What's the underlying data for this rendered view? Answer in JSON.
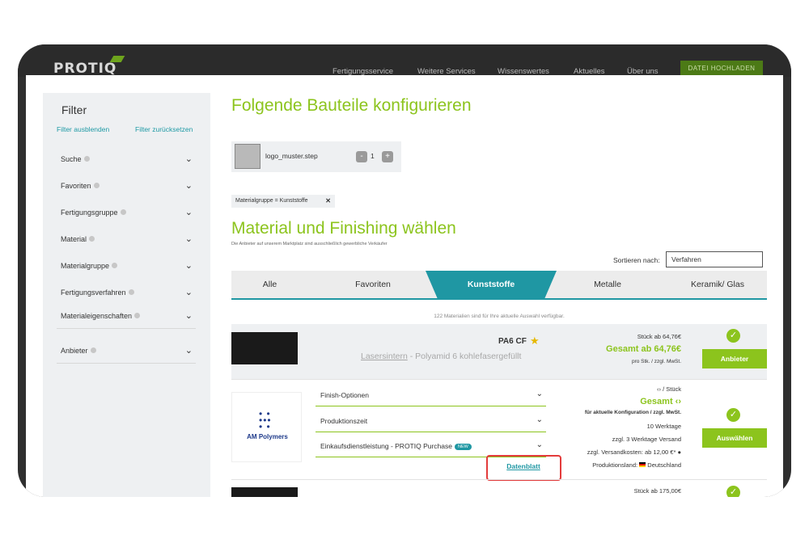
{
  "header": {
    "logo": "PROTIQ",
    "nav": [
      "Fertigungsservice",
      "Weitere Services",
      "Wissenswertes",
      "Aktuelles",
      "Über uns"
    ],
    "upload_button": "DATEI HOCHLADEN"
  },
  "sidebar": {
    "title": "Filter",
    "hide_link": "Filter ausblenden",
    "reset_link": "Filter zurücksetzen",
    "facets": [
      "Suche",
      "Favoriten",
      "Fertigungsgruppe",
      "Material",
      "Materialgruppe",
      "Fertigungsverfahren",
      "Materialeigenschaften",
      "Anbieter"
    ]
  },
  "configure": {
    "heading": "Folgende Bauteile konfigurieren",
    "part_name": "logo_muster.step",
    "quantity": "1",
    "minus": "-",
    "plus": "+"
  },
  "active_filter": {
    "label": "Materialgruppe = Kunststoffe",
    "remove": "✕"
  },
  "material": {
    "heading": "Material und Finishing wählen",
    "subnote": "Die Anbieter auf unserem Marktplatz sind ausschließlich gewerbliche Verkäufer",
    "sort_label": "Sortieren nach:",
    "sort_value": "Verfahren",
    "tabs": [
      "Alle",
      "Favoriten",
      "Kunststoffe",
      "Metalle",
      "Keramik/ Glas"
    ],
    "active_tab": "Kunststoffe",
    "count_text": "122 Materialien sind für Ihre aktuelle Auswahl verfügbar."
  },
  "result1": {
    "name": "PA6 CF",
    "process": "Lasersintern",
    "description": " - Polyamid 6 kohlefasergefüllt",
    "per_piece": "Stück ab 64,76€",
    "total": "Gesamt ab 64,76€",
    "note": "pro Stk. / zzgl. MwSt.",
    "button": "Anbieter"
  },
  "result1_detail": {
    "vendor": "AM Polymers",
    "options": [
      "Finish-Optionen",
      "Produktionszeit",
      "Einkaufsdienstleistung - PROTIQ Purchase"
    ],
    "new_badge": "NEW",
    "datasheet": "Datenblatt",
    "per_piece": "‹› / Stück",
    "total": "Gesamt ‹›",
    "config_note": "für aktuelle Konfiguration / zzgl. MwSt.",
    "workdays": "10 Werktage",
    "shipping_days": "zzgl. 3 Werktage Versand",
    "shipping_cost": "zzgl. Versandkosten: ab 12,00 €*",
    "country_label": "Produktionsland:",
    "country": "Deutschland",
    "button": "Auswählen"
  },
  "result2": {
    "per_piece": "Stück ab 175,00€"
  },
  "colors": {
    "accent_green": "#8cc41d",
    "accent_teal": "#1f97a3",
    "highlight_red": "#e33b3b"
  }
}
